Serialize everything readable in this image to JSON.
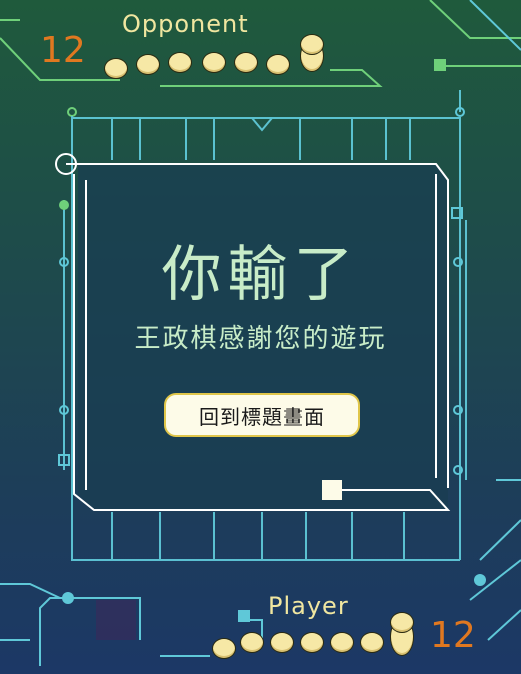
{
  "opponent": {
    "label": "Opponent",
    "score": "12",
    "coins": 8
  },
  "player": {
    "label": "Player",
    "score": "12",
    "coins": 8
  },
  "dialog": {
    "title": "你輸了",
    "subtitle": "王政棋感謝您的遊玩",
    "button_label": "回到標題畫面"
  },
  "colors": {
    "accent": "#e07820",
    "text": "#c8ecc8",
    "label": "#f0e6a0",
    "circuit": "#5fc8d8",
    "circuit_green": "#6fd07a",
    "coin": "#f6e8a6"
  }
}
